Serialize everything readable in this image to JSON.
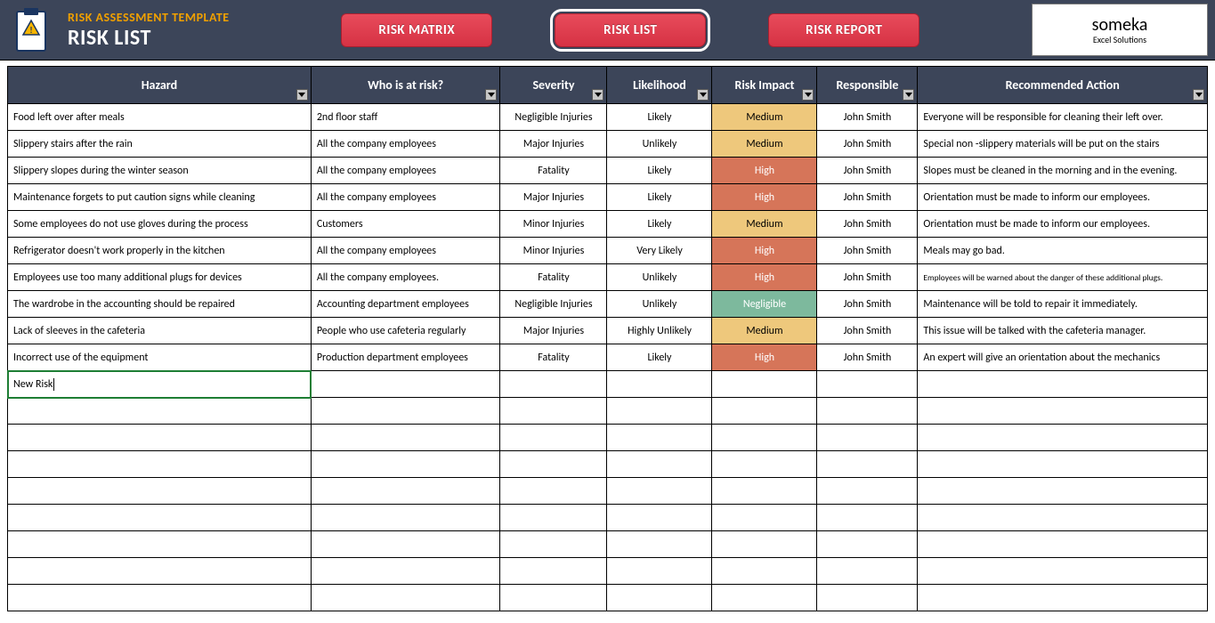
{
  "header": {
    "small_title": "RISK ASSESSMENT TEMPLATE",
    "large_title": "RISK LIST",
    "nav": {
      "matrix": "RISK MATRIX",
      "list": "RISK LIST",
      "report": "RISK REPORT"
    },
    "brand_main": "someka",
    "brand_sub": "Excel Solutions"
  },
  "columns": {
    "hazard": "Hazard",
    "who": "Who is at risk?",
    "severity": "Severity",
    "likelihood": "Likelihood",
    "impact": "Risk Impact",
    "responsible": "Responsible",
    "action": "Recommended Action"
  },
  "rows": [
    {
      "hazard": "Food left over after meals",
      "who": "2nd floor staff",
      "severity": "Negligible Injuries",
      "likelihood": "Likely",
      "impact": "Medium",
      "impact_class": "impact-medium",
      "responsible": "John Smith",
      "action": "Everyone will be responsible for cleaning their left over."
    },
    {
      "hazard": "Slippery stairs after the rain",
      "who": "All the company employees",
      "severity": "Major Injuries",
      "likelihood": "Unlikely",
      "impact": "Medium",
      "impact_class": "impact-medium",
      "responsible": "John Smith",
      "action": "Special non -slippery materials will be put on the stairs"
    },
    {
      "hazard": "Slippery slopes during the winter season",
      "who": "All the company employees",
      "severity": "Fatality",
      "likelihood": "Likely",
      "impact": "High",
      "impact_class": "impact-high",
      "responsible": "John Smith",
      "action": "Slopes must be cleaned in the morning and in the evening."
    },
    {
      "hazard": "Maintenance forgets to put caution signs while cleaning",
      "who": "All the company employees",
      "severity": "Major Injuries",
      "likelihood": "Likely",
      "impact": "High",
      "impact_class": "impact-high",
      "responsible": "John Smith",
      "action": "Orientation must be made to inform our employees."
    },
    {
      "hazard": "Some employees do not use gloves during the process",
      "who": "Customers",
      "severity": "Minor Injuries",
      "likelihood": "Likely",
      "impact": "Medium",
      "impact_class": "impact-medium",
      "responsible": "John Smith",
      "action": "Orientation must be made to inform our employees."
    },
    {
      "hazard": "Refrigerator doesn't work properly in the kitchen",
      "who": "All the company employees",
      "severity": "Minor Injuries",
      "likelihood": "Very Likely",
      "impact": "High",
      "impact_class": "impact-high",
      "responsible": "John Smith",
      "action": "Meals may go bad."
    },
    {
      "hazard": "Employees use too many additional plugs for  devices",
      "who": "All the company employees.",
      "severity": "Fatality",
      "likelihood": "Unlikely",
      "impact": "High",
      "impact_class": "impact-high",
      "responsible": "John Smith",
      "action": "Employees will be warned about the danger of these additional plugs."
    },
    {
      "hazard": "The wardrobe in the accounting should be repaired",
      "who": "Accounting department employees",
      "severity": "Negligible Injuries",
      "likelihood": "Unlikely",
      "impact": "Negligible",
      "impact_class": "impact-negligible",
      "responsible": "John Smith",
      "action": "Maintenance will be told to repair it immediately."
    },
    {
      "hazard": "Lack of sleeves in the cafeteria",
      "who": "People who use cafeteria regularly",
      "severity": "Major Injuries",
      "likelihood": "Highly Unlikely",
      "impact": "Medium",
      "impact_class": "impact-medium",
      "responsible": "John Smith",
      "action": "This issue will be talked with the cafeteria manager."
    },
    {
      "hazard": "Incorrect use of the equipment",
      "who": "Production department employees",
      "severity": "Fatality",
      "likelihood": "Likely",
      "impact": "High",
      "impact_class": "impact-high",
      "responsible": "John Smith",
      "action": "An expert will give an orientation about the mechanics"
    }
  ],
  "editing_row": {
    "hazard": "New Risk"
  },
  "empty_rows": 8
}
